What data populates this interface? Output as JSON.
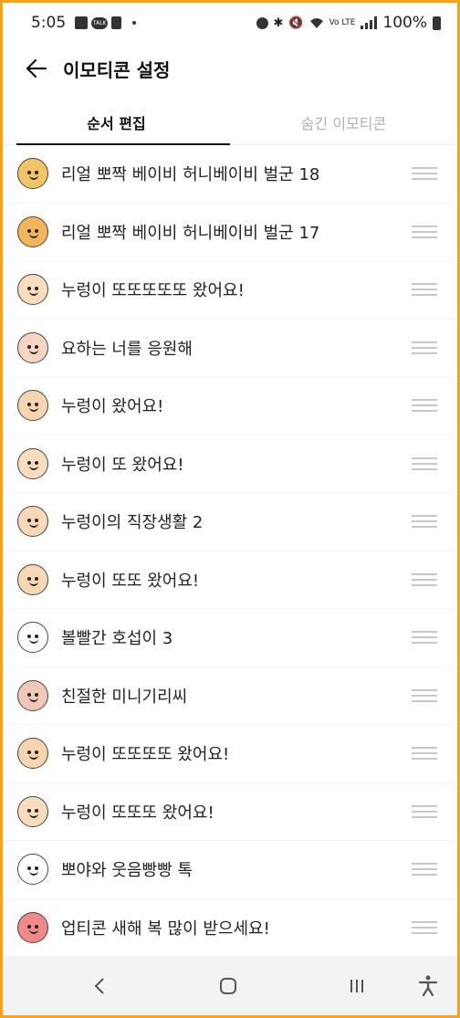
{
  "status_bar": {
    "time": "5:05",
    "talk_label": "TALK",
    "battery": "100%"
  },
  "header": {
    "title": "이모티콘 설정"
  },
  "tabs": [
    {
      "label": "순서 편집",
      "active": true
    },
    {
      "label": "숨긴 이모티콘",
      "active": false
    }
  ],
  "emoticons": [
    {
      "label": "리얼 뽀짝 베이비 허니베이비 벌군 18",
      "color": "#f2c46a",
      "icon": "bee-baby-icon"
    },
    {
      "label": "리얼 뽀짝 베이비 허니베이비 벌군 17",
      "color": "#f2b45c",
      "icon": "bee-baby-icon"
    },
    {
      "label": "누렁이 또또또또또 왔어요!",
      "color": "#f7dcbd",
      "icon": "dog-icon"
    },
    {
      "label": "요하는 너를 응원해",
      "color": "#f6d6c2",
      "icon": "boy-icon"
    },
    {
      "label": "누렁이 왔어요!",
      "color": "#f5d5b0",
      "icon": "dog-icon"
    },
    {
      "label": "누렁이 또 왔어요!",
      "color": "#f7dcbd",
      "icon": "dog-icon"
    },
    {
      "label": "누렁이의 직장생활 2",
      "color": "#f5d8b8",
      "icon": "dog-icon"
    },
    {
      "label": "누렁이 또또 왔어요!",
      "color": "#f6d8b6",
      "icon": "dog-icon"
    },
    {
      "label": "볼빨간 호섭이 3",
      "color": "#ffffff",
      "icon": "black-hair-kid-icon"
    },
    {
      "label": "친절한 미니기리씨",
      "color": "#f0c8b8",
      "icon": "round-face-icon"
    },
    {
      "label": "누렁이 또또또또 왔어요!",
      "color": "#f5d5b0",
      "icon": "dog-icon"
    },
    {
      "label": "누렁이 또또또 왔어요!",
      "color": "#f7dcbd",
      "icon": "dog-icon"
    },
    {
      "label": "뽀야와 웃음빵빵 톡",
      "color": "#ffffff",
      "icon": "bunny-girl-icon"
    },
    {
      "label": "업티콘 새해 복 많이 받으세요!",
      "color": "#f08a8a",
      "icon": "heart-icon"
    }
  ]
}
